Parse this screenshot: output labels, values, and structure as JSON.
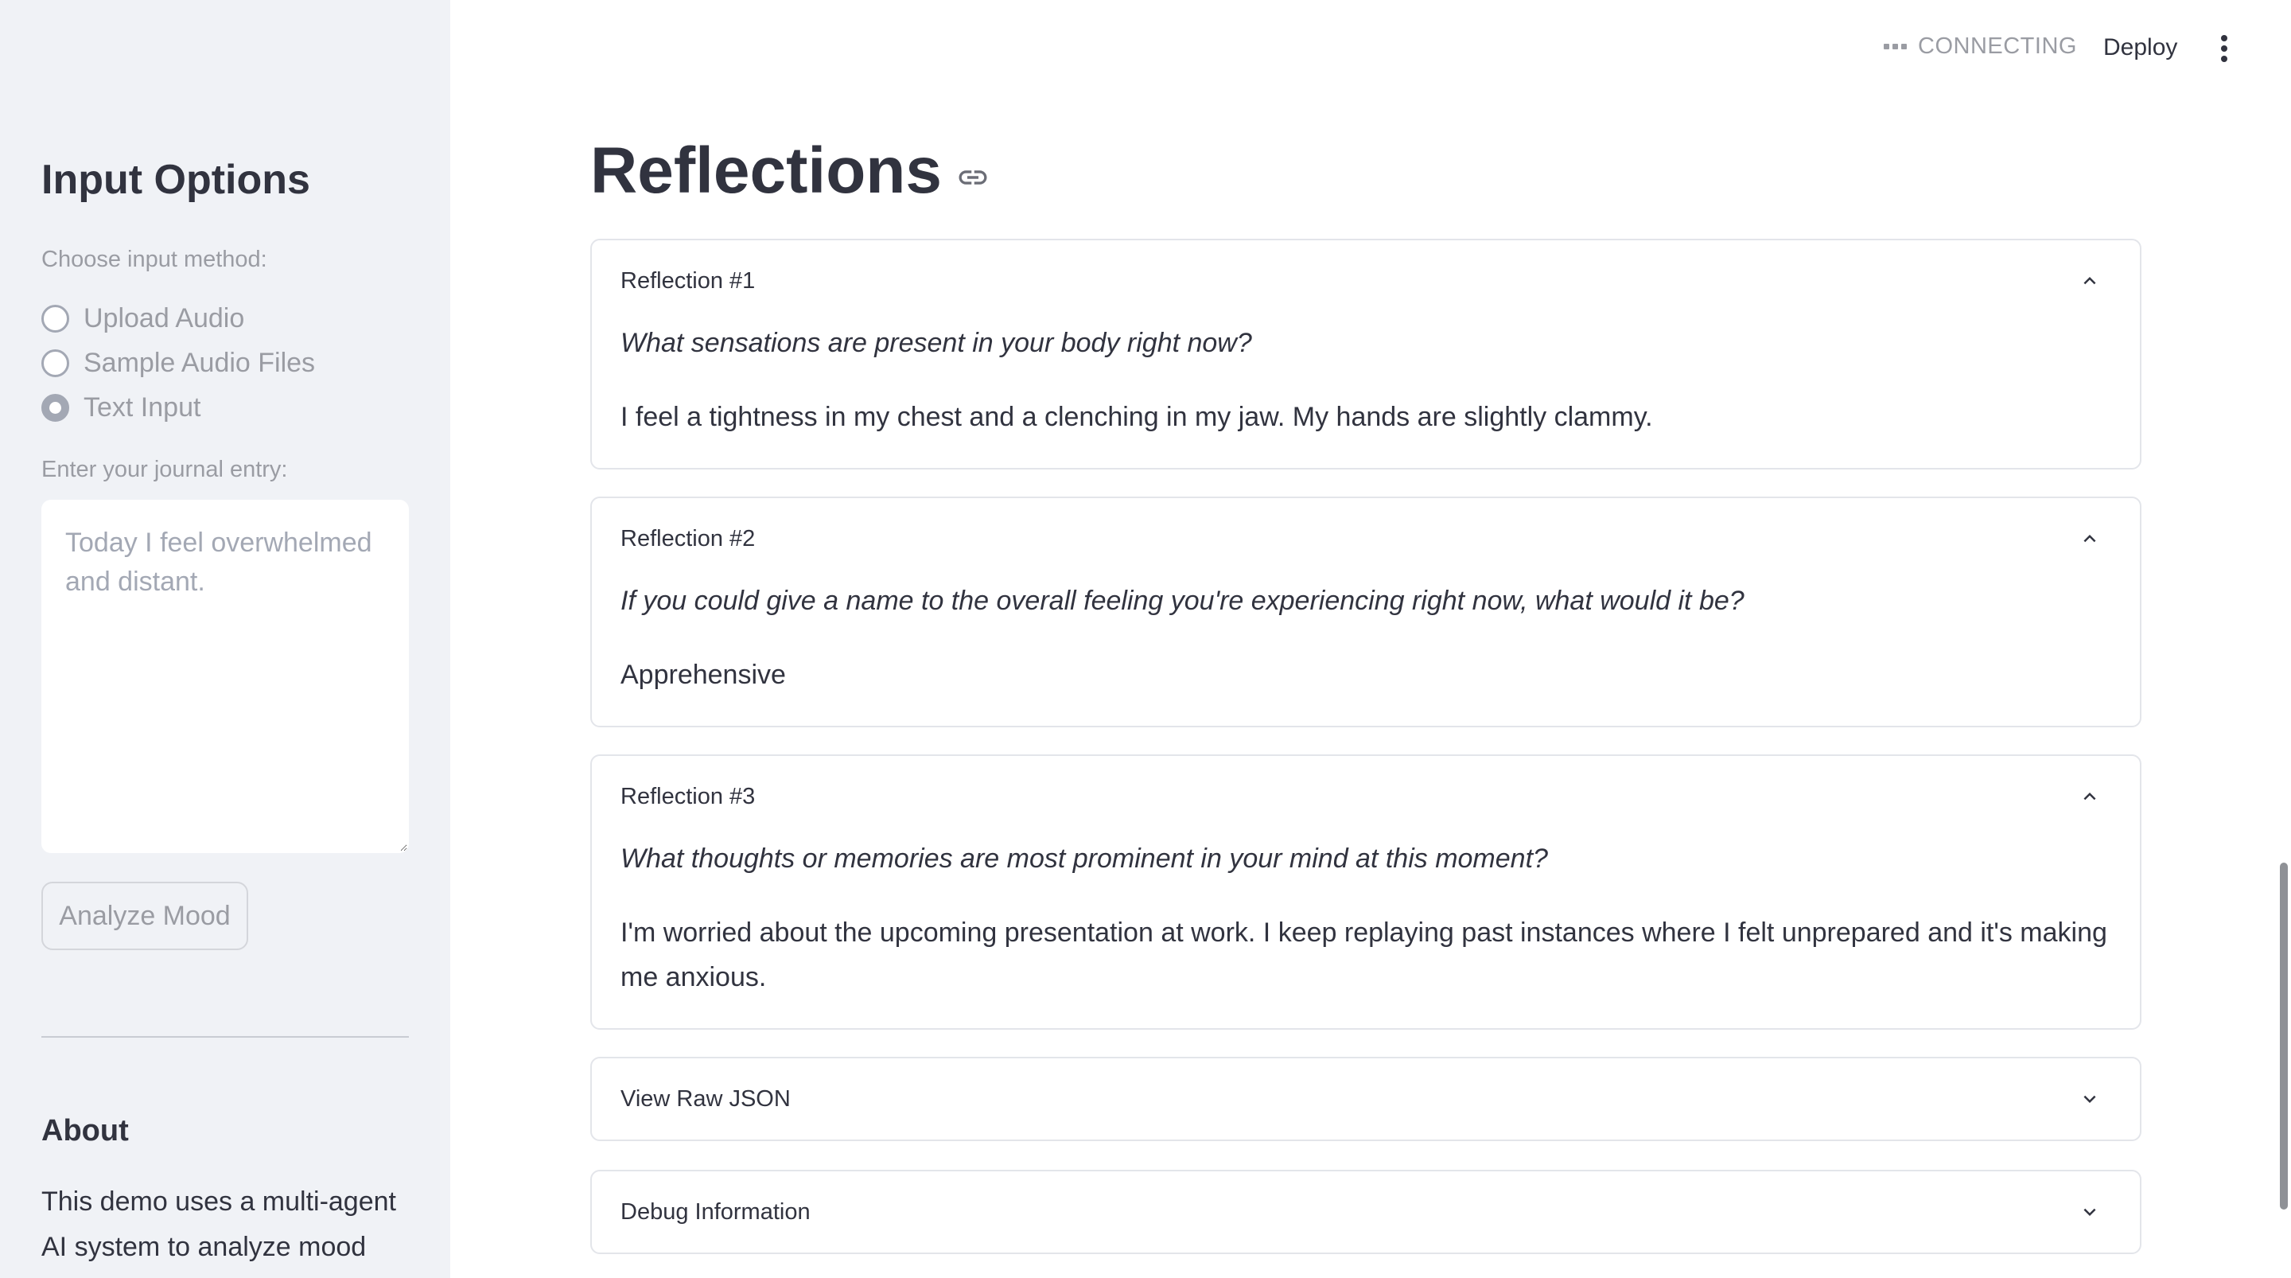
{
  "sidebar": {
    "title": "Input Options",
    "method_label": "Choose input method:",
    "options": [
      {
        "label": "Upload Audio",
        "checked": false
      },
      {
        "label": "Sample Audio Files",
        "checked": false
      },
      {
        "label": "Text Input",
        "checked": true
      }
    ],
    "journal_label": "Enter your journal entry:",
    "journal_placeholder": "Today I feel overwhelmed and distant.",
    "journal_value": "",
    "analyze_button": "Analyze Mood",
    "about_title": "About",
    "about_text": "This demo uses a multi-agent AI system to analyze mood"
  },
  "header": {
    "status": "CONNECTING",
    "deploy_label": "Deploy",
    "menu_icon": "kebab-menu-icon"
  },
  "main": {
    "title": "Reflections",
    "title_icon": "link-icon",
    "reflections": [
      {
        "label": "Reflection #1",
        "question": "What sensations are present in your body right now?",
        "answer": "I feel a tightness in my chest and a clenching in my jaw. My hands are slightly clammy.",
        "expanded": true
      },
      {
        "label": "Reflection #2",
        "question": "If you could give a name to the overall feeling you're experiencing right now, what would it be?",
        "answer": "Apprehensive",
        "expanded": true
      },
      {
        "label": "Reflection #3",
        "question": "What thoughts or memories are most prominent in your mind at this moment?",
        "answer": "I'm worried about the upcoming presentation at work. I keep replaying past instances where I felt unprepared and it's making me anxious.",
        "expanded": true
      }
    ],
    "collapsed_sections": [
      {
        "label": "View Raw JSON",
        "expanded": false
      },
      {
        "label": "Debug Information",
        "expanded": false
      }
    ]
  },
  "colors": {
    "sidebar_bg": "#f0f2f6",
    "text": "#31333f",
    "muted": "#9a9ca3",
    "border": "#e3e5ea"
  }
}
